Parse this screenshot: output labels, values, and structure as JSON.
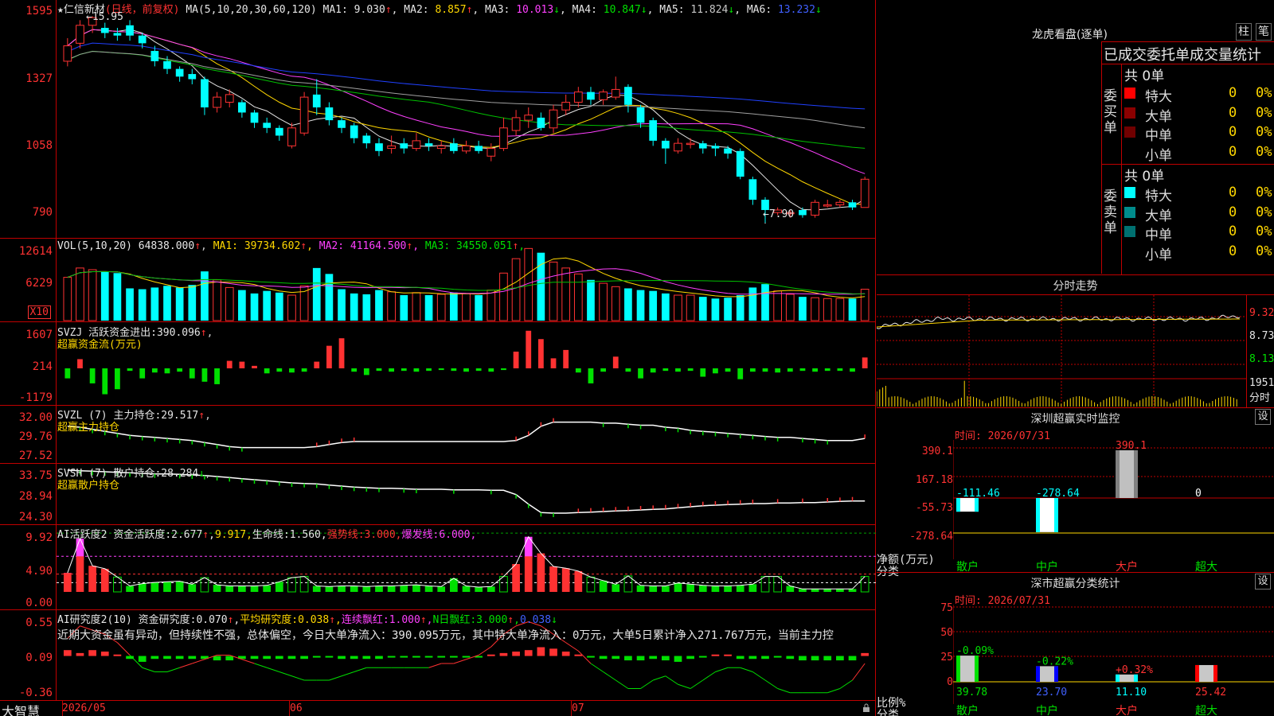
{
  "stock": {
    "star": "★",
    "name": "仁信新材",
    "period": "(日线，前复权)"
  },
  "kline": {
    "ma_label": "MA(5,10,20,30,60,120)",
    "ma": [
      {
        "label": "MA1:",
        "value": "9.030",
        "arrow": "↑",
        "color": "#e6e6e6"
      },
      {
        "label": "MA2:",
        "value": "8.857",
        "arrow": "↑",
        "color": "#ffd700"
      },
      {
        "label": "MA3:",
        "value": "10.013",
        "arrow": "↓",
        "color": "#ff40ff"
      },
      {
        "label": "MA4:",
        "value": "10.847",
        "arrow": "↓",
        "color": "#00e000"
      },
      {
        "label": "MA5:",
        "value": "11.824",
        "arrow": "↓",
        "color": "#c8c8c8"
      },
      {
        "label": "MA6:",
        "value": "13.232",
        "arrow": "↓",
        "color": "#4060ff"
      }
    ],
    "yticks": [
      "1595",
      "1327",
      "1058",
      "790"
    ],
    "high_label": "15.95",
    "low_label": "7.90",
    "candles": [
      {
        "o": 14.2,
        "c": 14.8,
        "h": 15.1,
        "l": 14.0
      },
      {
        "o": 14.9,
        "c": 15.6,
        "h": 15.8,
        "l": 14.7
      },
      {
        "o": 15.6,
        "c": 15.9,
        "h": 15.95,
        "l": 15.3
      },
      {
        "o": 15.5,
        "c": 15.3,
        "h": 15.7,
        "l": 15.1
      },
      {
        "o": 15.3,
        "c": 15.2,
        "h": 15.5,
        "l": 15.0
      },
      {
        "o": 15.6,
        "c": 15.2,
        "h": 15.8,
        "l": 15.0
      },
      {
        "o": 15.2,
        "c": 14.9,
        "h": 15.3,
        "l": 14.7
      },
      {
        "o": 14.6,
        "c": 14.2,
        "h": 14.8,
        "l": 14.0
      },
      {
        "o": 14.2,
        "c": 13.9,
        "h": 14.4,
        "l": 13.7
      },
      {
        "o": 13.9,
        "c": 13.6,
        "h": 14.0,
        "l": 13.4
      },
      {
        "o": 13.7,
        "c": 13.5,
        "h": 13.9,
        "l": 13.3
      },
      {
        "o": 13.5,
        "c": 12.4,
        "h": 13.6,
        "l": 12.1
      },
      {
        "o": 12.4,
        "c": 12.8,
        "h": 13.0,
        "l": 12.2
      },
      {
        "o": 12.6,
        "c": 12.9,
        "h": 13.1,
        "l": 12.4
      },
      {
        "o": 12.6,
        "c": 12.2,
        "h": 12.7,
        "l": 12.0
      },
      {
        "o": 12.2,
        "c": 11.8,
        "h": 12.3,
        "l": 11.6
      },
      {
        "o": 11.8,
        "c": 11.6,
        "h": 12.0,
        "l": 11.4
      },
      {
        "o": 11.6,
        "c": 11.3,
        "h": 11.7,
        "l": 11.1
      },
      {
        "o": 10.9,
        "c": 11.6,
        "h": 11.8,
        "l": 10.8
      },
      {
        "o": 11.4,
        "c": 12.8,
        "h": 13.0,
        "l": 11.3
      },
      {
        "o": 12.9,
        "c": 12.4,
        "h": 13.5,
        "l": 12.1
      },
      {
        "o": 12.4,
        "c": 11.9,
        "h": 12.6,
        "l": 11.7
      },
      {
        "o": 11.9,
        "c": 11.6,
        "h": 12.0,
        "l": 11.4
      },
      {
        "o": 11.7,
        "c": 11.2,
        "h": 11.8,
        "l": 11.0
      },
      {
        "o": 11.3,
        "c": 11.0,
        "h": 11.4,
        "l": 10.8
      },
      {
        "o": 11.0,
        "c": 10.7,
        "h": 11.2,
        "l": 10.5
      },
      {
        "o": 10.8,
        "c": 10.9,
        "h": 11.3,
        "l": 10.6
      },
      {
        "o": 11.0,
        "c": 10.8,
        "h": 11.2,
        "l": 10.6
      },
      {
        "o": 10.8,
        "c": 11.1,
        "h": 11.4,
        "l": 10.7
      },
      {
        "o": 11.0,
        "c": 10.9,
        "h": 11.2,
        "l": 10.7
      },
      {
        "o": 10.8,
        "c": 10.9,
        "h": 11.1,
        "l": 10.6
      },
      {
        "o": 11.0,
        "c": 10.7,
        "h": 11.2,
        "l": 10.6
      },
      {
        "o": 10.7,
        "c": 10.9,
        "h": 11.1,
        "l": 10.6
      },
      {
        "o": 10.9,
        "c": 10.7,
        "h": 11.1,
        "l": 10.6
      },
      {
        "o": 10.5,
        "c": 10.8,
        "h": 11.0,
        "l": 10.3
      },
      {
        "o": 10.8,
        "c": 11.6,
        "h": 12.0,
        "l": 10.7
      },
      {
        "o": 11.5,
        "c": 12.0,
        "h": 12.3,
        "l": 11.3
      },
      {
        "o": 11.9,
        "c": 12.1,
        "h": 12.4,
        "l": 11.6
      },
      {
        "o": 12.0,
        "c": 11.6,
        "h": 12.2,
        "l": 11.5
      },
      {
        "o": 11.6,
        "c": 12.3,
        "h": 12.5,
        "l": 11.4
      },
      {
        "o": 12.3,
        "c": 12.6,
        "h": 12.9,
        "l": 12.1
      },
      {
        "o": 12.6,
        "c": 13.0,
        "h": 13.2,
        "l": 12.4
      },
      {
        "o": 13.0,
        "c": 12.7,
        "h": 13.2,
        "l": 12.5
      },
      {
        "o": 12.7,
        "c": 13.0,
        "h": 13.1,
        "l": 12.5
      },
      {
        "o": 12.8,
        "c": 13.1,
        "h": 13.6,
        "l": 12.7
      },
      {
        "o": 13.2,
        "c": 12.5,
        "h": 13.3,
        "l": 12.2
      },
      {
        "o": 12.4,
        "c": 11.8,
        "h": 12.5,
        "l": 11.6
      },
      {
        "o": 11.9,
        "c": 11.1,
        "h": 12.0,
        "l": 10.9
      },
      {
        "o": 11.1,
        "c": 10.8,
        "h": 11.2,
        "l": 10.2
      },
      {
        "o": 10.7,
        "c": 11.0,
        "h": 11.2,
        "l": 10.6
      },
      {
        "o": 11.0,
        "c": 11.0,
        "h": 11.2,
        "l": 10.8
      },
      {
        "o": 11.0,
        "c": 10.8,
        "h": 11.1,
        "l": 10.6
      },
      {
        "o": 10.9,
        "c": 10.8,
        "h": 11.0,
        "l": 10.5
      },
      {
        "o": 10.8,
        "c": 10.6,
        "h": 10.9,
        "l": 10.4
      },
      {
        "o": 10.7,
        "c": 9.7,
        "h": 10.8,
        "l": 9.6
      },
      {
        "o": 9.6,
        "c": 8.8,
        "h": 9.7,
        "l": 8.6
      },
      {
        "o": 8.8,
        "c": 8.4,
        "h": 8.9,
        "l": 7.9
      },
      {
        "o": 8.3,
        "c": 8.4,
        "h": 8.5,
        "l": 8.2
      },
      {
        "o": 8.3,
        "c": 8.3,
        "h": 8.4,
        "l": 8.1
      },
      {
        "o": 8.4,
        "c": 8.2,
        "h": 8.5,
        "l": 8.1
      },
      {
        "o": 8.2,
        "c": 8.7,
        "h": 8.8,
        "l": 8.1
      },
      {
        "o": 8.6,
        "c": 8.6,
        "h": 8.8,
        "l": 8.5
      },
      {
        "o": 8.6,
        "c": 8.7,
        "h": 8.8,
        "l": 8.5
      },
      {
        "o": 8.7,
        "c": 8.5,
        "h": 8.8,
        "l": 8.4
      },
      {
        "o": 8.5,
        "c": 9.6,
        "h": 9.7,
        "l": 8.5
      }
    ]
  },
  "vol": {
    "title": "VOL(5,10,20)",
    "value": "64838.000",
    "arrow": "↑",
    "ma": [
      {
        "label": "MA1:",
        "value": "39734.602",
        "arrow": "↑",
        "color": "#ffd700"
      },
      {
        "label": "MA2:",
        "value": "41164.500",
        "arrow": "↑",
        "color": "#ff40ff"
      },
      {
        "label": "MA3:",
        "value": "34550.051",
        "arrow": "↑",
        "color": "#00e000"
      }
    ],
    "yticks": [
      "12614",
      "6229"
    ],
    "unit": "X10",
    "bars": [
      5.1,
      6.2,
      6.0,
      5.8,
      5.6,
      3.8,
      3.7,
      3.9,
      4.1,
      3.9,
      4.2,
      5.8,
      4.8,
      3.9,
      3.6,
      3.2,
      3.5,
      3.3,
      3.0,
      4.1,
      6.2,
      5.5,
      3.7,
      3.2,
      3.1,
      3.6,
      3.4,
      3.0,
      3.3,
      3.0,
      3.1,
      3.3,
      3.2,
      3.0,
      3.6,
      5.6,
      7.3,
      8.5,
      8.0,
      6.9,
      6.2,
      5.5,
      4.8,
      4.4,
      4.0,
      3.8,
      3.6,
      3.5,
      3.2,
      3.0,
      3.0,
      2.8,
      2.6,
      2.7,
      3.0,
      3.9,
      4.3,
      3.5,
      3.1,
      2.8,
      2.7,
      2.6,
      2.6,
      2.6,
      3.7
    ]
  },
  "svzj": {
    "name": "SVZJ",
    "title": "活跃资金进出:",
    "value": "390.096",
    "arrow": "↑",
    "sub": "超赢资金流(万元)",
    "yticks": [
      "1607",
      "214",
      "-1179"
    ],
    "values": [
      -120,
      110,
      -180,
      -310,
      -250,
      -30,
      -120,
      -50,
      -60,
      -40,
      -120,
      -160,
      -190,
      90,
      80,
      30,
      -60,
      -40,
      -50,
      -40,
      80,
      270,
      360,
      -40,
      -80,
      -30,
      -40,
      -30,
      -40,
      -30,
      -20,
      -30,
      -40,
      -30,
      -40,
      -20,
      200,
      450,
      350,
      120,
      220,
      -50,
      -180,
      -40,
      140,
      -40,
      -120,
      -50,
      -30,
      -40,
      -30,
      -100,
      -60,
      -40,
      -130,
      -40,
      -40,
      -50,
      -40,
      -30,
      -40,
      -30,
      -30,
      -40,
      130
    ]
  },
  "svzl": {
    "name": "SVZL (7)",
    "title": "主力持仓:",
    "value": "29.517",
    "arrow": "↑",
    "sub": "超赢主力持仓",
    "yticks": [
      "32.00",
      "29.76",
      "27.52"
    ],
    "values": [
      30.7,
      30.6,
      30.4,
      30.2,
      30.0,
      29.8,
      29.7,
      29.6,
      29.5,
      29.4,
      29.3,
      29.1,
      28.9,
      28.7,
      28.6,
      28.6,
      28.6,
      28.6,
      28.6,
      28.6,
      28.7,
      28.9,
      29.1,
      29.2,
      29.2,
      29.2,
      29.2,
      29.2,
      29.2,
      29.2,
      29.2,
      29.2,
      29.2,
      29.2,
      29.2,
      29.2,
      29.3,
      29.8,
      30.7,
      31.1,
      31.1,
      31.1,
      31.1,
      31.0,
      31.0,
      30.9,
      30.8,
      30.8,
      30.6,
      30.5,
      30.3,
      30.2,
      30.1,
      30.0,
      29.9,
      29.8,
      29.7,
      29.6,
      29.6,
      29.5,
      29.4,
      29.3,
      29.3,
      29.3,
      29.5
    ]
  },
  "svsh": {
    "name": "SVSH (7)",
    "title": "散户持仓:",
    "value": "28.284",
    "arrow": "↓",
    "sub": "超赢散户持仓",
    "yticks": [
      "33.75",
      "28.94",
      "24.30"
    ],
    "values": [
      33.6,
      33.5,
      33.4,
      33.3,
      33.2,
      33.1,
      33.0,
      32.9,
      32.9,
      32.8,
      32.7,
      32.6,
      32.4,
      32.2,
      32.0,
      31.8,
      31.6,
      31.4,
      31.2,
      31.1,
      31.0,
      30.8,
      30.6,
      30.4,
      30.3,
      30.2,
      30.2,
      30.1,
      30.0,
      30.0,
      30.0,
      29.9,
      29.9,
      29.9,
      29.8,
      29.8,
      29.0,
      27.2,
      25.6,
      25.5,
      25.5,
      25.6,
      25.7,
      25.8,
      25.9,
      26.0,
      26.1,
      26.2,
      26.3,
      26.5,
      26.7,
      26.9,
      27.0,
      27.1,
      27.2,
      27.3,
      27.3,
      27.4,
      27.4,
      27.5,
      27.5,
      27.6,
      27.7,
      27.8,
      27.8
    ]
  },
  "ai1": {
    "name": "AI活跃度2",
    "items": [
      {
        "text": "资金活跃度:",
        "color": "#e6e6e6"
      },
      {
        "text": "2.677",
        "color": "#e6e6e6"
      },
      {
        "text": "↑",
        "color": "#ff3232"
      },
      {
        "text": ",",
        "color": "#e6e6e6"
      },
      {
        "text": "9.917,",
        "color": "#ffd700"
      },
      {
        "text": "生命线:",
        "color": "#e6e6e6"
      },
      {
        "text": "1.560,",
        "color": "#e6e6e6"
      },
      {
        "text": "强势线:",
        "color": "#ff3232"
      },
      {
        "text": "3.000,",
        "color": "#ff3232"
      },
      {
        "text": "爆发线:",
        "color": "#ff40ff"
      },
      {
        "text": "6.000,",
        "color": "#ff40ff"
      }
    ],
    "yticks": [
      "9.92",
      "4.90",
      "0.00"
    ],
    "values": [
      3.2,
      9.0,
      4.4,
      3.9,
      2.5,
      1.0,
      1.4,
      1.6,
      1.7,
      1.8,
      1.3,
      2.4,
      1.2,
      1.0,
      1.0,
      1.0,
      1.1,
      1.7,
      2.4,
      2.6,
      1.0,
      0.9,
      1.0,
      1.0,
      0.9,
      1.0,
      1.0,
      1.1,
      1.2,
      1.0,
      0.9,
      2.3,
      1.0,
      0.8,
      0.9,
      2.6,
      4.7,
      9.3,
      6.5,
      4.3,
      4.0,
      3.5,
      2.5,
      1.9,
      1.3,
      2.7,
      1.1,
      1.0,
      1.0,
      1.5,
      1.3,
      1.1,
      1.0,
      1.0,
      1.1,
      1.3,
      2.6,
      2.6,
      1.0,
      0.5,
      0.5,
      0.5,
      0.5,
      0.5,
      2.6
    ],
    "high_flags": [
      1,
      1,
      0,
      0,
      0,
      0,
      0,
      0,
      0,
      0,
      0,
      0,
      0,
      0,
      0,
      0,
      0,
      0,
      0,
      0,
      0,
      0,
      0,
      0,
      0,
      0,
      0,
      0,
      0,
      0,
      0,
      0,
      0,
      0,
      0,
      0,
      0,
      1,
      0,
      0,
      0,
      0,
      0,
      0,
      0,
      0,
      0,
      0,
      0,
      0,
      0,
      0,
      0,
      0,
      0,
      0,
      0,
      0,
      0,
      0,
      0,
      0,
      0,
      0,
      0
    ]
  },
  "ai2": {
    "name": "AI研究度2(10)",
    "items": [
      {
        "text": "资金研究度:",
        "color": "#e6e6e6"
      },
      {
        "text": "0.070",
        "color": "#e6e6e6"
      },
      {
        "text": "↑",
        "color": "#ff3232"
      },
      {
        "text": ",",
        "color": "#e6e6e6"
      },
      {
        "text": "平均研究度:",
        "color": "#ffd700"
      },
      {
        "text": "0.038",
        "color": "#ffd700"
      },
      {
        "text": "↑",
        "color": "#ff3232"
      },
      {
        "text": ",",
        "color": "#ffd700"
      },
      {
        "text": "连续飘红:",
        "color": "#ff40ff"
      },
      {
        "text": "1.000",
        "color": "#ff40ff"
      },
      {
        "text": "↑",
        "color": "#ff3232"
      },
      {
        "text": ",",
        "color": "#ff40ff"
      },
      {
        "text": "N日飘红:",
        "color": "#00e000"
      },
      {
        "text": "3.000",
        "color": "#00e000"
      },
      {
        "text": "↑",
        "color": "#ff3232"
      },
      {
        "text": ",",
        "color": "#00e000"
      },
      {
        "text": "0.038",
        "color": "#4060ff"
      },
      {
        "text": "↓",
        "color": "#00e000"
      }
    ],
    "comment": "近期大资金虽有异动，但持续性不强，总体偏空，今日大单净流入：390.095万元，其中特大单净流入：0万元，大单5日累计净入271.767万元，当前主力控",
    "yticks": [
      "0.55",
      "0.09",
      "-0.36"
    ],
    "bars": [
      0.2,
      0.1,
      0.2,
      0.15,
      0.05,
      -0.1,
      -0.2,
      -0.1,
      -0.1,
      -0.1,
      -0.1,
      -0.1,
      -0.15,
      -0.15,
      -0.1,
      -0.1,
      -0.1,
      -0.1,
      -0.1,
      -0.1,
      -0.05,
      -0.05,
      -0.1,
      -0.1,
      -0.1,
      -0.1,
      -0.05,
      -0.05,
      -0.05,
      -0.05,
      -0.05,
      -0.05,
      -0.05,
      -0.05,
      0.05,
      0.1,
      0.15,
      0.2,
      0.3,
      0.25,
      0.15,
      0.05,
      -0.05,
      -0.1,
      -0.1,
      -0.15,
      -0.15,
      -0.1,
      -0.15,
      -0.2,
      -0.1,
      -0.05,
      0.05,
      0.05,
      -0.1,
      -0.1,
      -0.1,
      -0.05,
      -0.1,
      -0.15,
      -0.15,
      -0.15,
      -0.15,
      -0.15,
      0.1
    ],
    "line": [
      0.3,
      0.45,
      0.4,
      0.35,
      0.25,
      0.1,
      -0.05,
      -0.1,
      -0.1,
      -0.05,
      0.0,
      0.05,
      0.1,
      0.1,
      0.05,
      0.0,
      -0.05,
      -0.1,
      -0.15,
      -0.2,
      -0.2,
      -0.2,
      -0.15,
      -0.1,
      -0.05,
      -0.05,
      -0.05,
      -0.05,
      -0.05,
      -0.05,
      0.0,
      0.0,
      0.05,
      0.1,
      0.2,
      0.35,
      0.45,
      0.5,
      0.45,
      0.35,
      0.25,
      0.15,
      0.0,
      -0.1,
      -0.2,
      -0.3,
      -0.3,
      -0.2,
      -0.15,
      -0.25,
      -0.3,
      -0.2,
      -0.1,
      -0.05,
      -0.05,
      -0.1,
      -0.2,
      -0.3,
      -0.35,
      -0.35,
      -0.35,
      -0.35,
      -0.3,
      -0.2,
      0.0
    ]
  },
  "xaxis": {
    "labels": [
      "2026/05",
      "06",
      "07"
    ],
    "brand": "大智慧"
  },
  "lhb": {
    "title": "龙虎看盘(逐单)",
    "btn1": "柱",
    "btn2": "笔",
    "header": "已成交委托单成交量统计",
    "buy": {
      "side": "委买单",
      "total": "共 0单",
      "rows": [
        {
          "label": "特大",
          "count": "0",
          "pct": "0%",
          "color": "#ff0000"
        },
        {
          "label": "大单",
          "count": "0",
          "pct": "0%",
          "color": "#8b0000"
        },
        {
          "label": "中单",
          "count": "0",
          "pct": "0%",
          "color": "#700000"
        },
        {
          "label": "小单",
          "count": "0",
          "pct": "0%",
          "color": "#000000"
        }
      ]
    },
    "sell": {
      "side": "委卖单",
      "total": "共 0单",
      "rows": [
        {
          "label": "特大",
          "count": "0",
          "pct": "0%",
          "color": "#00ffff"
        },
        {
          "label": "大单",
          "count": "0",
          "pct": "0%",
          "color": "#008b8b"
        },
        {
          "label": "中单",
          "count": "0",
          "pct": "0%",
          "color": "#007070"
        },
        {
          "label": "小单",
          "count": "0",
          "pct": "0%",
          "color": "#000000"
        }
      ]
    }
  },
  "fenshi": {
    "title": "分时走势",
    "yticks": [
      "9.32",
      "8.73",
      "8.13",
      "1951",
      "分时"
    ]
  },
  "sz": {
    "title": "深圳超赢实时监控",
    "time": "时间: 2026/07/31",
    "set": "设",
    "axis_title": "净额(万元)",
    "cat_title": "分类",
    "yticks": [
      "390.1",
      "167.18",
      "-55.73",
      "-278.64"
    ],
    "cats": [
      "散户",
      "中户",
      "大户",
      "超大"
    ],
    "values": [
      -111.46,
      -278.64,
      390.1,
      0
    ],
    "labels": [
      "-111.46",
      "-278.64",
      "390.1",
      "0"
    ]
  },
  "ss": {
    "title": "深市超赢分类统计",
    "time": "时间: 2026/07/31",
    "set": "设",
    "axis_title": "比例%",
    "cat_title": "分类",
    "yticks": [
      "75",
      "50",
      "25",
      "0"
    ],
    "cats": [
      "散户",
      "中户",
      "大户",
      "超大"
    ],
    "values": [
      39.78,
      23.7,
      11.1,
      25.42
    ],
    "labels": [
      "39.78",
      "23.70",
      "11.10",
      "25.42"
    ],
    "changes": [
      "-0.09%",
      "-0.22%",
      "+0.32%",
      ""
    ]
  }
}
